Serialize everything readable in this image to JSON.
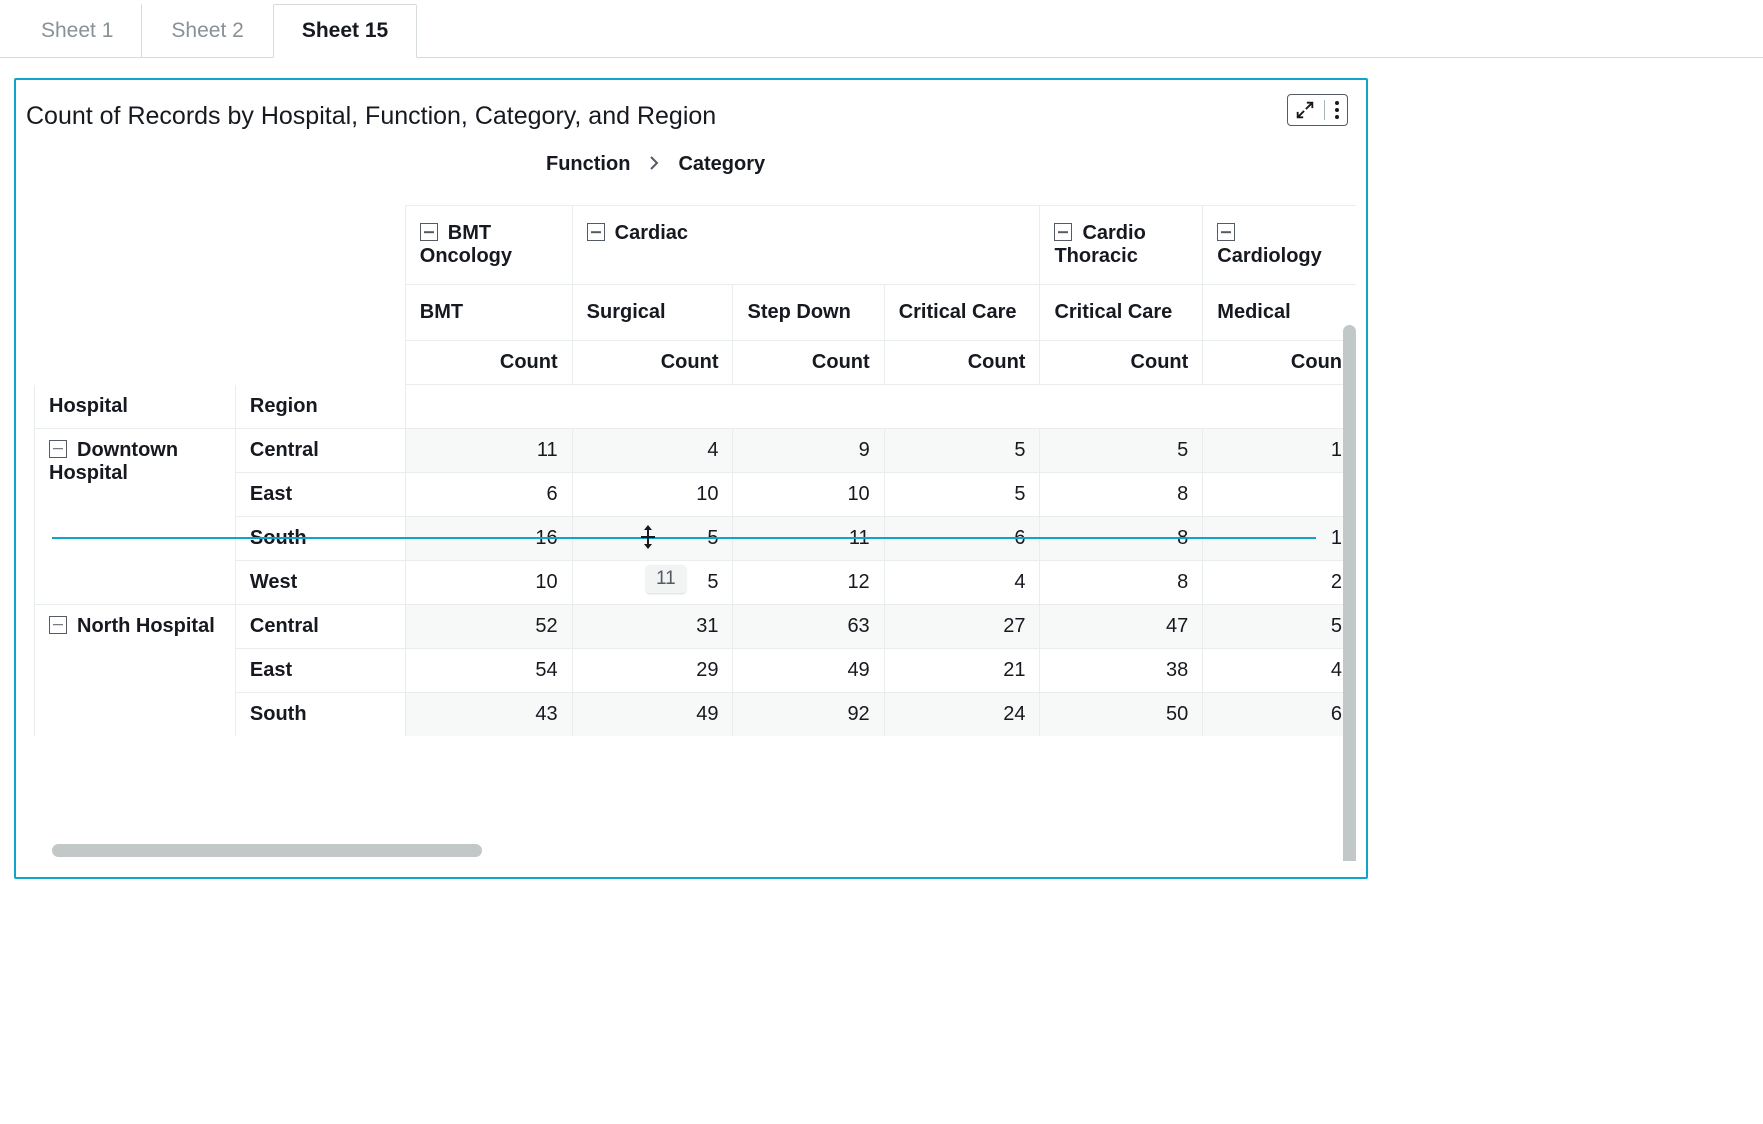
{
  "tabs": [
    "Sheet 1",
    "Sheet 2",
    "Sheet 15"
  ],
  "active_tab": 2,
  "panel_title": "Count of Records by Hospital, Function, Category, and Region",
  "breadcrumb": {
    "items": [
      "Function",
      "Category"
    ]
  },
  "row_dims": [
    "Hospital",
    "Region"
  ],
  "functions": [
    {
      "name": "BMT Oncology",
      "categories": [
        "BMT"
      ]
    },
    {
      "name": "Cardiac",
      "categories": [
        "Surgical",
        "Step Down",
        "Critical Care"
      ]
    },
    {
      "name": "Cardio Thoracic",
      "categories": [
        "Critical Care"
      ]
    },
    {
      "name": "Cardiology",
      "categories": [
        "Medical"
      ]
    }
  ],
  "measure_label": "Count",
  "measure_label_last": "Coun",
  "rows": [
    {
      "hospital": "Downtown Hospital",
      "region": "Central",
      "vals": [
        "11",
        "4",
        "9",
        "5",
        "5",
        "1"
      ]
    },
    {
      "hospital": "",
      "region": "East",
      "vals": [
        "6",
        "10",
        "10",
        "5",
        "8",
        ""
      ]
    },
    {
      "hospital": "",
      "region": "South",
      "vals": [
        "16",
        "5",
        "11",
        "6",
        "8",
        "1"
      ]
    },
    {
      "hospital": "",
      "region": "West",
      "vals": [
        "10",
        "5",
        "12",
        "4",
        "8",
        "2"
      ]
    },
    {
      "hospital": "North Hospital",
      "region": "Central",
      "vals": [
        "52",
        "31",
        "63",
        "27",
        "47",
        "5"
      ]
    },
    {
      "hospital": "",
      "region": "East",
      "vals": [
        "54",
        "29",
        "49",
        "21",
        "38",
        "4"
      ]
    },
    {
      "hospital": "",
      "region": "South",
      "vals": [
        "43",
        "49",
        "92",
        "24",
        "50",
        "6"
      ]
    }
  ],
  "drag": {
    "tooltip": "11"
  },
  "icons": {
    "expand": "expand",
    "more": "more"
  }
}
